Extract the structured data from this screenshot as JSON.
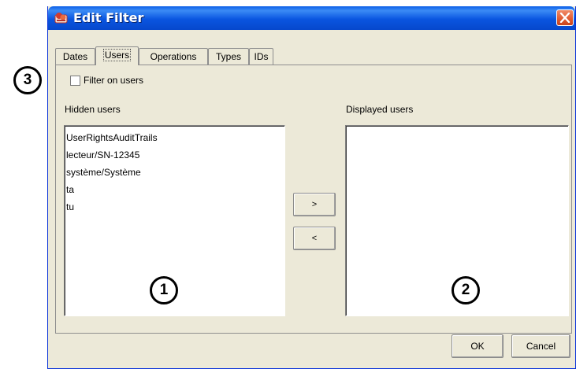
{
  "window": {
    "title": "Edit Filter"
  },
  "tabs": [
    {
      "label": "Dates",
      "active": false
    },
    {
      "label": "Users",
      "active": true
    },
    {
      "label": "Operations",
      "active": false
    },
    {
      "label": "Types",
      "active": false
    },
    {
      "label": "IDs",
      "active": false
    }
  ],
  "filter": {
    "checkbox_label": "Filter on users",
    "checked": false
  },
  "hidden_users": {
    "label": "Hidden users",
    "items": [
      "UserRightsAuditTrails",
      "lecteur/SN-12345",
      "système/Système",
      "ta",
      "tu"
    ]
  },
  "displayed_users": {
    "label": "Displayed users",
    "items": []
  },
  "move_buttons": {
    "right": ">",
    "left": "<"
  },
  "footer": {
    "ok": "OK",
    "cancel": "Cancel"
  },
  "callouts": {
    "one": "1",
    "two": "2",
    "three": "3"
  },
  "colors": {
    "titlebar": "#0a5fe8",
    "close": "#e05a2f",
    "face": "#ece9d8"
  }
}
